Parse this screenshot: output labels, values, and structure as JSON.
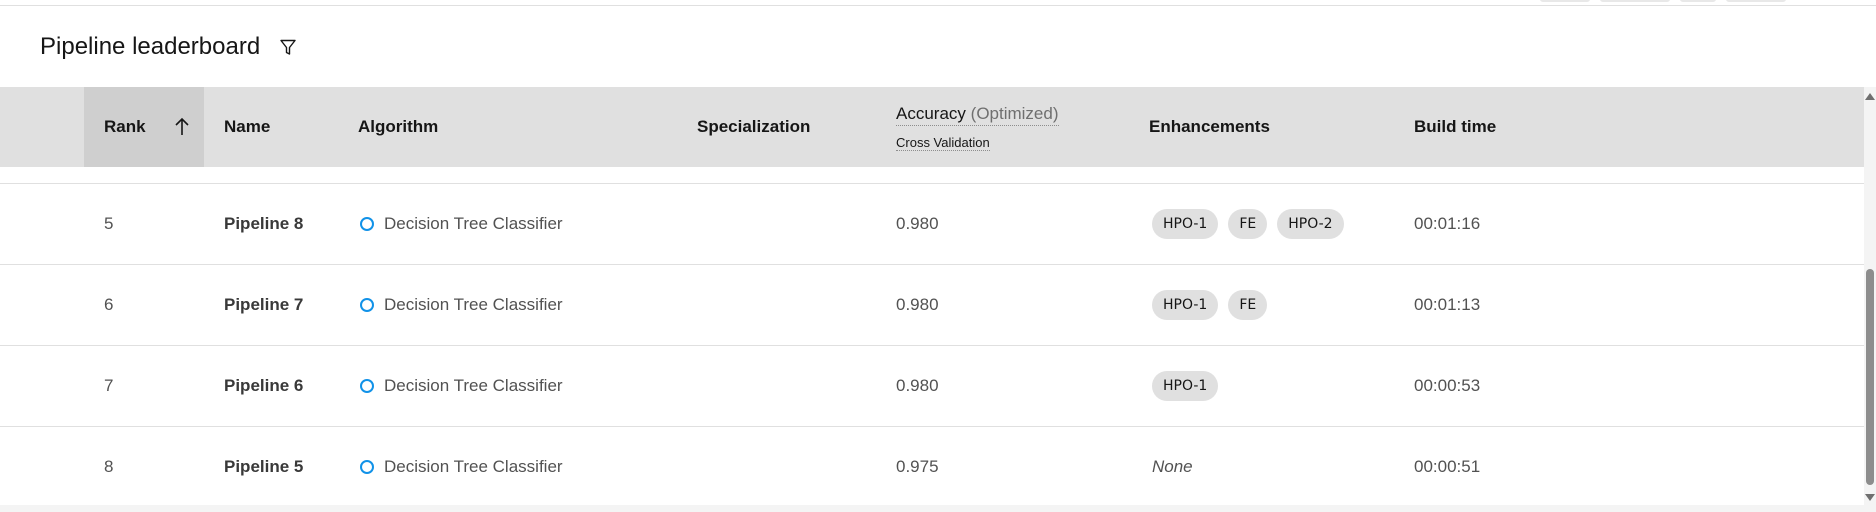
{
  "panel": {
    "title": "Pipeline leaderboard",
    "filter_icon": "filter-icon"
  },
  "columns": {
    "rank": "Rank",
    "name": "Name",
    "algorithm": "Algorithm",
    "specialization": "Specialization",
    "accuracy": "Accuracy",
    "accuracy_suffix": "(Optimized)",
    "accuracy_sub": "Cross Validation",
    "enhancements": "Enhancements",
    "build_time": "Build time"
  },
  "sort": {
    "column": "Rank",
    "direction": "ascending",
    "icon": "arrow-up-icon"
  },
  "rows": [
    {
      "rank": "5",
      "name": "Pipeline 8",
      "algorithm": "Decision Tree Classifier",
      "specialization": "",
      "accuracy": "0.980",
      "enhancements": [
        "HPO-1",
        "FE",
        "HPO-2"
      ],
      "build_time": "00:01:16"
    },
    {
      "rank": "6",
      "name": "Pipeline 7",
      "algorithm": "Decision Tree Classifier",
      "specialization": "",
      "accuracy": "0.980",
      "enhancements": [
        "HPO-1",
        "FE"
      ],
      "build_time": "00:01:13"
    },
    {
      "rank": "7",
      "name": "Pipeline 6",
      "algorithm": "Decision Tree Classifier",
      "specialization": "",
      "accuracy": "0.980",
      "enhancements": [
        "HPO-1"
      ],
      "build_time": "00:00:53"
    },
    {
      "rank": "8",
      "name": "Pipeline 5",
      "algorithm": "Decision Tree Classifier",
      "specialization": "",
      "accuracy": "0.975",
      "enhancements": [],
      "enhancements_empty": "None",
      "build_time": "00:00:51"
    }
  ],
  "colors": {
    "algorithm_dot": "#1192e8",
    "header_bg": "#e0e0e0",
    "sorted_header_bg": "#cfcfcf",
    "tag_bg": "#e0e0e0"
  }
}
